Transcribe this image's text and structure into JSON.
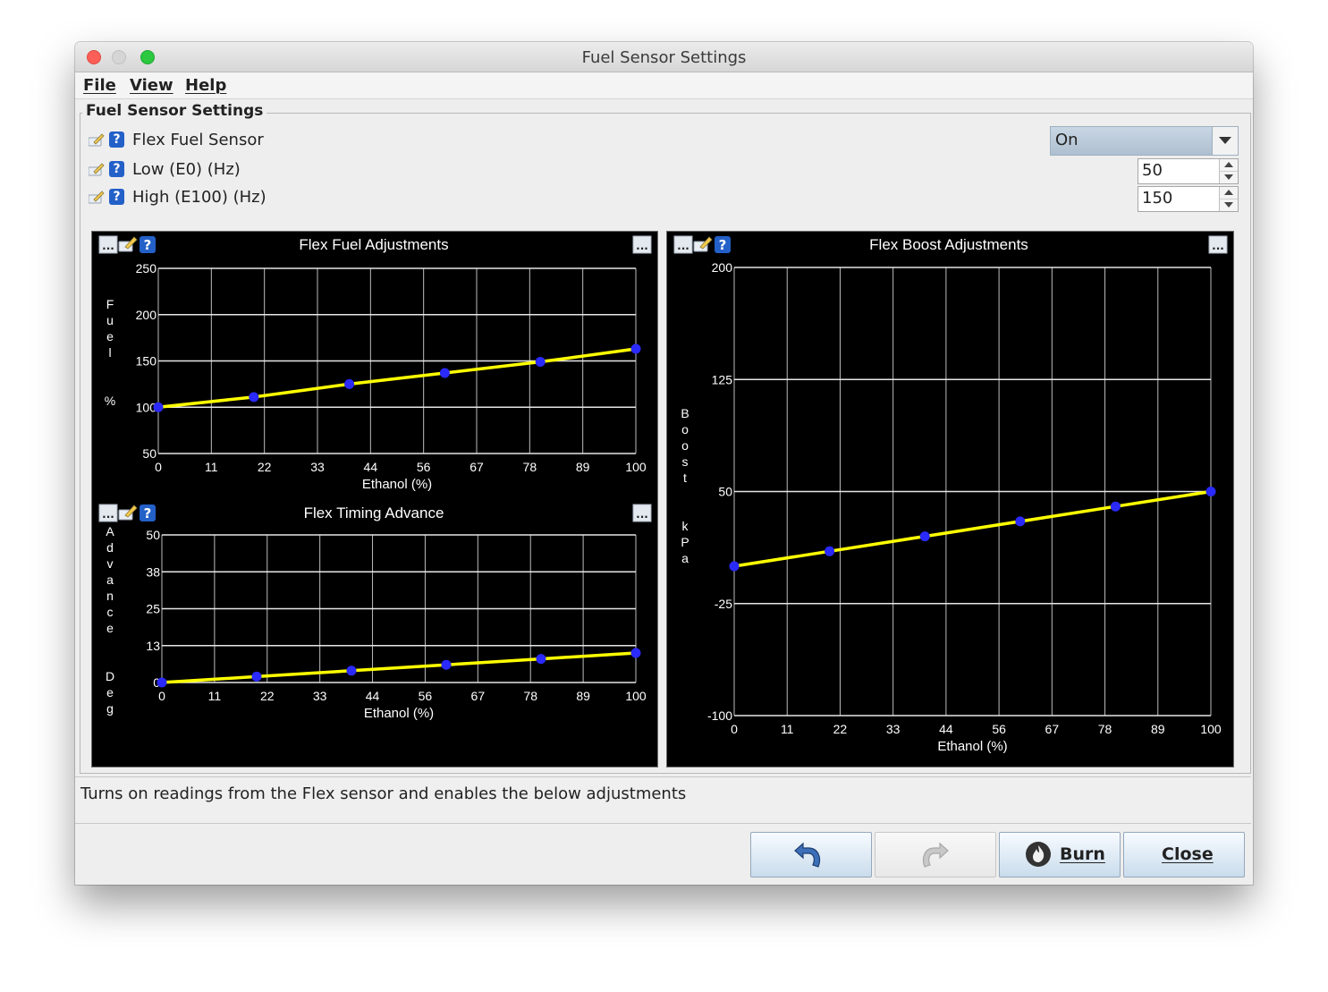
{
  "window": {
    "title": "Fuel Sensor Settings"
  },
  "menu": {
    "file": "File",
    "view": "View",
    "help": "Help"
  },
  "group": {
    "title": "Fuel Sensor Settings"
  },
  "settings": [
    {
      "label": "Flex Fuel Sensor",
      "value": "On",
      "type": "dropdown"
    },
    {
      "label": "Low (E0) (Hz)",
      "value": "50",
      "type": "spinner"
    },
    {
      "label": "High (E100) (Hz)",
      "value": "150",
      "type": "spinner"
    }
  ],
  "status_text": "Turns on readings from the Flex sensor and enables the below adjustments",
  "buttons": {
    "burn": "Burn",
    "close": "Close"
  },
  "icons": {
    "pencil": "pencil-icon",
    "help": "help-icon",
    "more": "more-icon",
    "undo": "undo-icon",
    "redo": "redo-icon",
    "burn": "flame-icon",
    "dropdown": "chevron-down-icon"
  },
  "colors": {
    "line": "#ffff00",
    "point": "#2a2aff",
    "grid": "#cfcfcf",
    "panel": "#000000"
  },
  "chart_data": [
    {
      "type": "line",
      "title": "Flex Fuel Adjustments",
      "xlabel": "Ethanol (%)",
      "ylabel": "Fuel %",
      "x_ticks": [
        "0",
        "11",
        "22",
        "33",
        "44",
        "56",
        "67",
        "78",
        "89",
        "100"
      ],
      "y_ticks": [
        "250",
        "200",
        "150",
        "100",
        "50"
      ],
      "ylim": [
        50,
        250
      ],
      "grid": true,
      "x": [
        0,
        20,
        40,
        60,
        80,
        100
      ],
      "y": [
        100,
        111,
        125,
        137,
        149,
        163
      ]
    },
    {
      "type": "line",
      "title": "Flex Timing Advance",
      "xlabel": "Ethanol (%)",
      "ylabel": "Advance Deg",
      "x_ticks": [
        "0",
        "11",
        "22",
        "33",
        "44",
        "56",
        "67",
        "78",
        "89",
        "100"
      ],
      "y_ticks": [
        "50",
        "38",
        "25",
        "13",
        "0"
      ],
      "ylim": [
        0,
        50
      ],
      "grid": true,
      "x": [
        0,
        20,
        40,
        60,
        80,
        100
      ],
      "y": [
        0,
        2,
        4,
        6,
        8,
        10
      ]
    },
    {
      "type": "line",
      "title": "Flex Boost Adjustments",
      "xlabel": "Ethanol (%)",
      "ylabel": "Boost kPa",
      "x_ticks": [
        "0",
        "11",
        "22",
        "33",
        "44",
        "56",
        "67",
        "78",
        "89",
        "100"
      ],
      "y_ticks": [
        "200",
        "125",
        "50",
        "-25",
        "-100"
      ],
      "ylim": [
        -100,
        200
      ],
      "grid": true,
      "x": [
        0,
        20,
        40,
        60,
        80,
        100
      ],
      "y": [
        0,
        10,
        20,
        30,
        40,
        50
      ]
    }
  ]
}
